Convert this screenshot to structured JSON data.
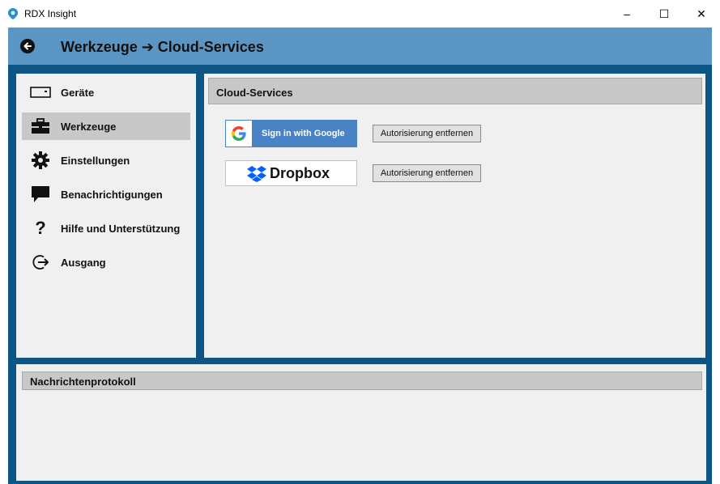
{
  "window": {
    "title": "RDX Insight",
    "minimize": "–",
    "maximize": "☐",
    "close": "✕"
  },
  "header": {
    "title": "Werkzeuge ➔ Cloud-Services",
    "back_icon": "back-arrow-circle-icon"
  },
  "sidebar": {
    "items": [
      {
        "label": "Geräte",
        "icon": "drive-icon",
        "active": false
      },
      {
        "label": "Werkzeuge",
        "icon": "toolbox-icon",
        "active": true
      },
      {
        "label": "Einstellungen",
        "icon": "gear-icon",
        "active": false
      },
      {
        "label": "Benachrichtigungen",
        "icon": "speech-bubble-icon",
        "active": false
      },
      {
        "label": "Hilfe und Unterstützung",
        "icon": "question-icon",
        "active": false
      },
      {
        "label": "Ausgang",
        "icon": "exit-icon",
        "active": false
      }
    ]
  },
  "content": {
    "section_title": "Cloud-Services",
    "google": {
      "label": "Sign in with Google",
      "icon": "google-g-icon"
    },
    "dropbox": {
      "label": "Dropbox",
      "icon": "dropbox-icon"
    },
    "remove_auth_google": "Autorisierung entfernen",
    "remove_auth_dropbox": "Autorisierung entfernen"
  },
  "log": {
    "title": "Nachrichtenprotokoll"
  },
  "colors": {
    "header_bg": "#5b95c3",
    "frame_bg": "#0d5584",
    "panel_bg": "#f0f0f0",
    "active_item": "#c8c8c8",
    "google_blue": "#4a82c6",
    "dropbox_blue": "#0061fe"
  }
}
